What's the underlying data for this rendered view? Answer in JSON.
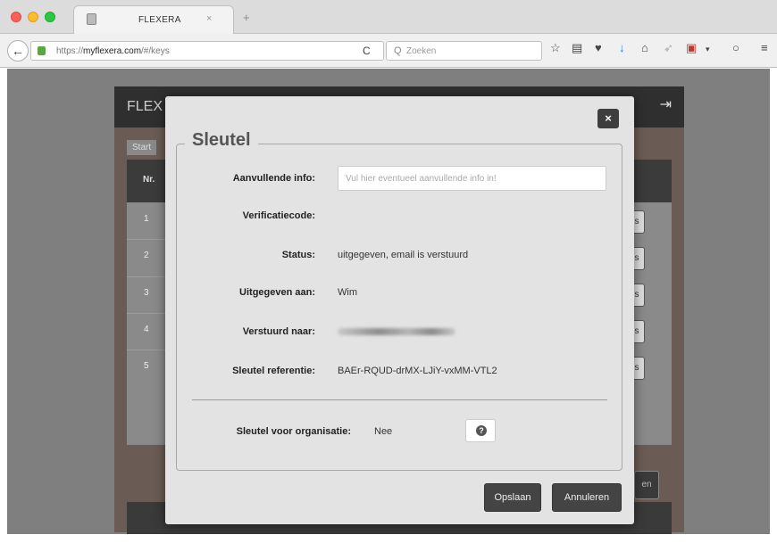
{
  "browser": {
    "tab_title": "FLEXERA",
    "tab_close": "×",
    "new_tab": "+",
    "back": "←",
    "url_prefix": "https://",
    "url_host": "myflexera.com",
    "url_path": "/#/keys",
    "reload": "C",
    "search_placeholder": "Zoeken",
    "search_glyph": "Q"
  },
  "app": {
    "logo": "FLEX",
    "start_tab": "Start",
    "header_nr": "Nr.",
    "rows": [
      "1",
      "2",
      "3",
      "4",
      "5"
    ],
    "row_button": "s",
    "footer_button": "en"
  },
  "modal": {
    "title": "Sleutel",
    "close": "×",
    "fields": {
      "extra_info_label": "Aanvullende info:",
      "extra_info_placeholder": "Vul hier eventueel aanvullende info in!",
      "verification_label": "Verificatiecode:",
      "status_label": "Status:",
      "status_value": "uitgegeven, email is verstuurd",
      "issued_to_label": "Uitgegeven aan:",
      "issued_to_value": "Wim",
      "sent_to_label": "Verstuurd naar:",
      "key_ref_label": "Sleutel referentie:",
      "key_ref_value": "BAEr-RQUD-drMX-LJiY-vxMM-VTL2",
      "org_key_label": "Sleutel voor organisatie:",
      "org_key_value": "Nee"
    },
    "help_icon": "?",
    "save_label": "Opslaan",
    "cancel_label": "Annuleren"
  },
  "colors": {
    "modal_bg": "#e3e3e3",
    "button_dark": "#444444",
    "close_bg": "#3e3e3e"
  }
}
